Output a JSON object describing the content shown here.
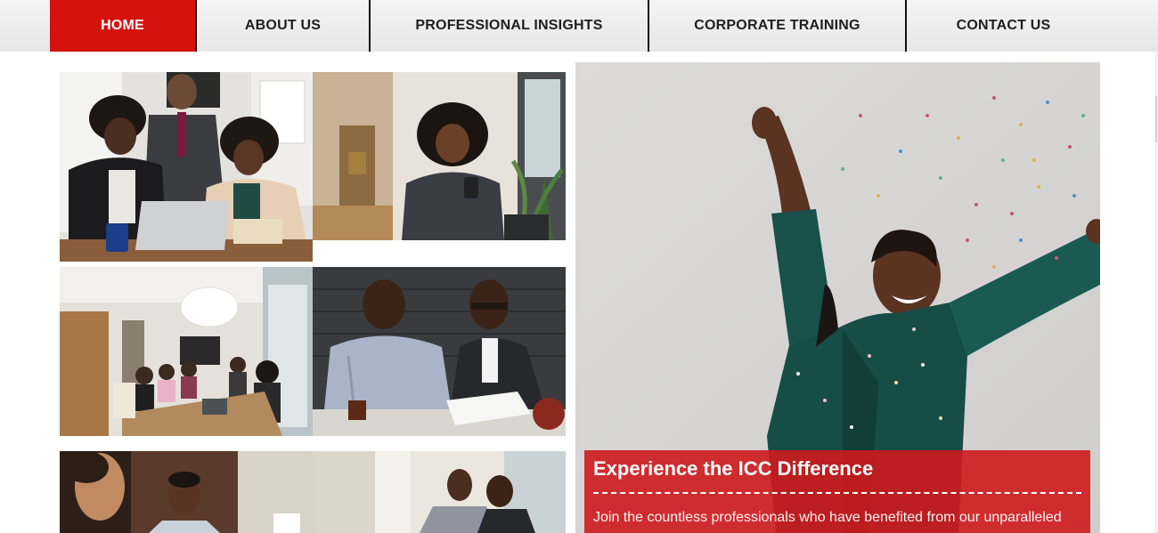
{
  "nav": {
    "items": [
      {
        "label": "HOME",
        "active": true
      },
      {
        "label": "ABOUT US",
        "active": false
      },
      {
        "label": "PROFESSIONAL INSIGHTS",
        "active": false
      },
      {
        "label": "CORPORATE TRAINING",
        "active": false
      },
      {
        "label": "CONTACT US",
        "active": false
      }
    ],
    "active_color": "#d6120f"
  },
  "gallery": {
    "photos": [
      {
        "alt": "team reviewing laptop"
      },
      {
        "alt": "woman using phone in office hallway"
      },
      {
        "alt": "conference room meeting"
      },
      {
        "alt": "two men discussing documents"
      },
      {
        "alt": "man in suit at office"
      },
      {
        "alt": "two men looking at tablet"
      }
    ]
  },
  "hero": {
    "image_alt": "woman celebrating with confetti",
    "caption_title": "Experience the ICC Difference",
    "caption_text": "Join the countless professionals who have benefited from our unparalleled",
    "caption_color": "#ce191d"
  }
}
